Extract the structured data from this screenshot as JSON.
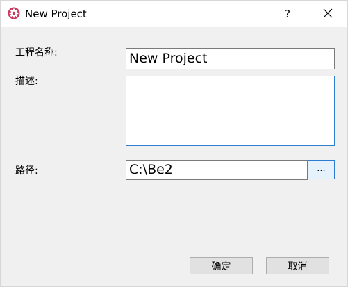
{
  "window": {
    "title": "New Project",
    "help_label": "?",
    "app_icon": "app-gear-icon",
    "close_icon": "close-icon"
  },
  "form": {
    "name_label": "工程名称:",
    "name_value": "New Project",
    "description_label": "描述:",
    "description_value": "",
    "path_label": "路径:",
    "path_value": "C:\\Be2",
    "browse_label": "..."
  },
  "buttons": {
    "ok_label": "确定",
    "cancel_label": "取消"
  },
  "colors": {
    "accent": "#2d7fcf",
    "app_icon": "#c8385a"
  }
}
